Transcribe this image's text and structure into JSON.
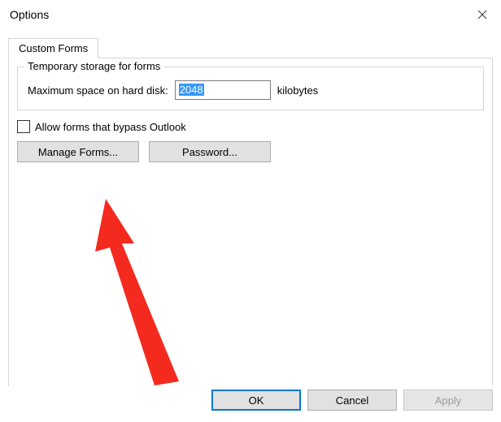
{
  "window": {
    "title": "Options"
  },
  "tabs": [
    {
      "label": "Custom Forms"
    }
  ],
  "storage_group": {
    "title": "Temporary storage for forms",
    "disk_label": "Maximum space on hard disk:",
    "disk_value": "2048",
    "units": "kilobytes"
  },
  "allow_bypass": {
    "label": "Allow forms that bypass Outlook",
    "checked": false
  },
  "buttons": {
    "manage_forms": "Manage Forms...",
    "password": "Password..."
  },
  "dialog_buttons": {
    "ok": "OK",
    "cancel": "Cancel",
    "apply": "Apply"
  },
  "colors": {
    "annotation_arrow": "#f42a1f"
  }
}
